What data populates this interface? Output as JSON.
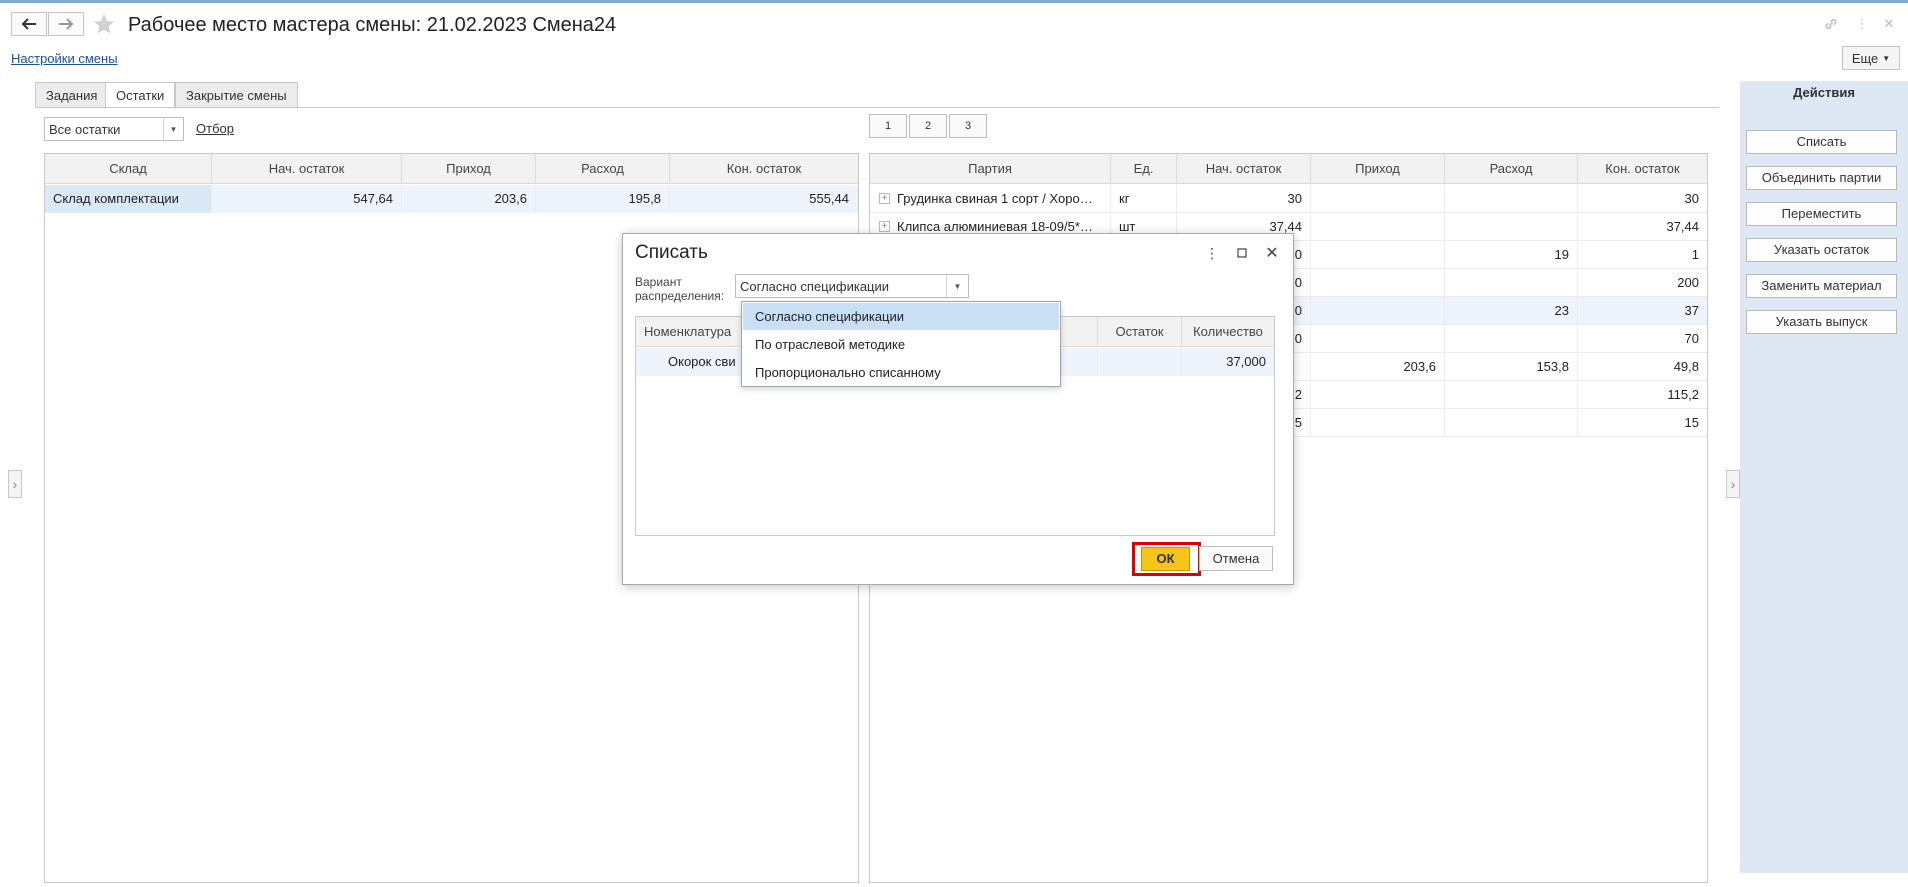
{
  "window": {
    "title": "Рабочее место мастера смены: 21.02.2023 Смена24",
    "settings_link": "Настройки смены",
    "more_label": "Еще"
  },
  "tabs": [
    {
      "label": "Задания"
    },
    {
      "label": "Остатки",
      "active": true
    },
    {
      "label": "Закрытие смены"
    }
  ],
  "left_panel": {
    "filter_value": "Все остатки",
    "filter_link": "Отбор",
    "columns": [
      "Склад",
      "Нач. остаток",
      "Приход",
      "Расход",
      "Кон. остаток"
    ],
    "rows": [
      {
        "sklad": "Склад комплектации",
        "nach": "547,64",
        "prihod": "203,6",
        "rashod": "195,8",
        "kon": "555,44"
      }
    ]
  },
  "right_panel": {
    "page_buttons": [
      "1",
      "2",
      "3"
    ],
    "columns": [
      "Партия",
      "Ед.",
      "Нач. остаток",
      "Приход",
      "Расход",
      "Кон. остаток"
    ],
    "rows": [
      {
        "partiya": "Грудинка свиная 1 сорт / Хоро…",
        "ed": "кг",
        "nach": "30",
        "prihod": "",
        "rashod": "",
        "kon": "30"
      },
      {
        "partiya": "Клипса алюминиевая 18-09/5*…",
        "ed": "шт",
        "nach": "37,44",
        "prihod": "",
        "rashod": "",
        "kon": "37,44"
      },
      {
        "partiya": "",
        "ed": "",
        "nach": "0",
        "prihod": "",
        "rashod": "19",
        "kon": "1"
      },
      {
        "partiya": "",
        "ed": "",
        "nach": "0",
        "prihod": "",
        "rashod": "",
        "kon": "200"
      },
      {
        "partiya": "",
        "ed": "",
        "nach": "0",
        "prihod": "",
        "rashod": "23",
        "kon": "37"
      },
      {
        "partiya": "",
        "ed": "",
        "nach": "0",
        "prihod": "",
        "rashod": "",
        "kon": "70"
      },
      {
        "partiya": "",
        "ed": "",
        "nach": "",
        "prihod": "203,6",
        "rashod": "153,8",
        "kon": "49,8"
      },
      {
        "partiya": "",
        "ed": "",
        "nach": "2",
        "prihod": "",
        "rashod": "",
        "kon": "115,2"
      },
      {
        "partiya": "",
        "ed": "",
        "nach": "5",
        "prihod": "",
        "rashod": "",
        "kon": "15"
      }
    ]
  },
  "actions": {
    "title": "Действия",
    "buttons": [
      "Списать",
      "Объединить партии",
      "Переместить",
      "Указать остаток",
      "Заменить материал",
      "Указать выпуск"
    ]
  },
  "dialog": {
    "title": "Списать",
    "variant_label_1": "Вариант",
    "variant_label_2": "распределения:",
    "variant_value": "Согласно спецификации",
    "columns": [
      "Номенклатура",
      "Остаток",
      "Количество"
    ],
    "rows": [
      {
        "nomenklatura": "Окорок сви",
        "ostatok": "",
        "kolichestvo": "37,000"
      }
    ],
    "dropdown_options": [
      "Согласно спецификации",
      "По отраслевой методике",
      "Пропорционально списанному"
    ],
    "selected_option_index": 0,
    "ok_label": "ОК",
    "cancel_label": "Отмена"
  },
  "colors": {
    "accent_highlight": "#e00000",
    "ok_button": "#f5c518",
    "actions_panel_bg": "#dde8f4",
    "selected_row_bg": "#e3eefa"
  }
}
